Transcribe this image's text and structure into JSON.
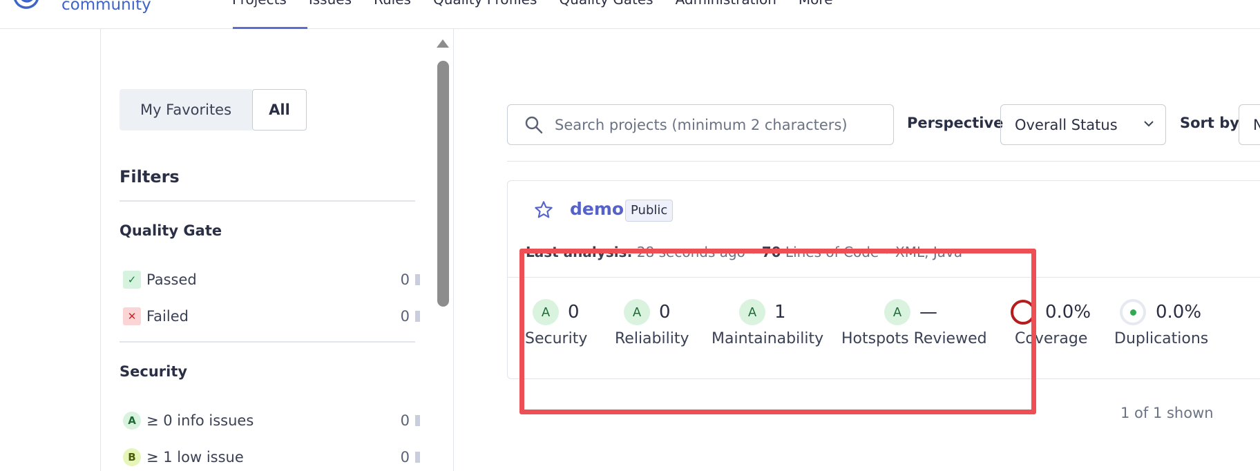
{
  "brand": {
    "name": "community"
  },
  "nav": {
    "items": [
      {
        "label": "Projects"
      },
      {
        "label": "Issues"
      },
      {
        "label": "Rules"
      },
      {
        "label": "Quality Profiles"
      },
      {
        "label": "Quality Gates"
      },
      {
        "label": "Administration"
      },
      {
        "label": "More"
      }
    ],
    "active": "Projects"
  },
  "sidebar": {
    "toggle": {
      "favorites": "My Favorites",
      "all": "All",
      "selected": "All"
    },
    "filters_title": "Filters",
    "quality_gate": {
      "title": "Quality Gate",
      "items": [
        {
          "icon": "check-icon",
          "label": "Passed",
          "count": "0"
        },
        {
          "icon": "cross-icon",
          "label": "Failed",
          "count": "0"
        }
      ]
    },
    "security": {
      "title": "Security",
      "items": [
        {
          "rating": "A",
          "label": "≥ 0 info issues",
          "count": "0"
        },
        {
          "rating": "B",
          "label": "≥ 1 low issue",
          "count": "0"
        }
      ]
    }
  },
  "toolbar": {
    "search_placeholder": "Search projects (minimum 2 characters)",
    "perspective_label": "Perspective",
    "perspective_value": "Overall Status",
    "sort_label": "Sort by",
    "sort_value": "N"
  },
  "project": {
    "name": "demo",
    "visibility": "Public",
    "analysis_label": "Last analysis:",
    "analysis_time": "28 seconds ago",
    "loc_value": "70",
    "loc_label": "Lines of Code",
    "languages": "XML, Java",
    "metrics": [
      {
        "rating": "A",
        "value": "0",
        "label": "Security"
      },
      {
        "rating": "A",
        "value": "0",
        "label": "Reliability"
      },
      {
        "rating": "A",
        "value": "1",
        "label": "Maintainability"
      },
      {
        "rating": "A",
        "value": "—",
        "label": "Hotspots Reviewed"
      },
      {
        "value": "0.0%",
        "label": "Coverage"
      },
      {
        "value": "0.0%",
        "label": "Duplications"
      }
    ]
  },
  "results": {
    "shown": "1 of 1 shown"
  },
  "colors": {
    "accent": "#5d6cd1",
    "highlight": "#ee4f55",
    "rating_a_bg": "#d9f3df"
  }
}
